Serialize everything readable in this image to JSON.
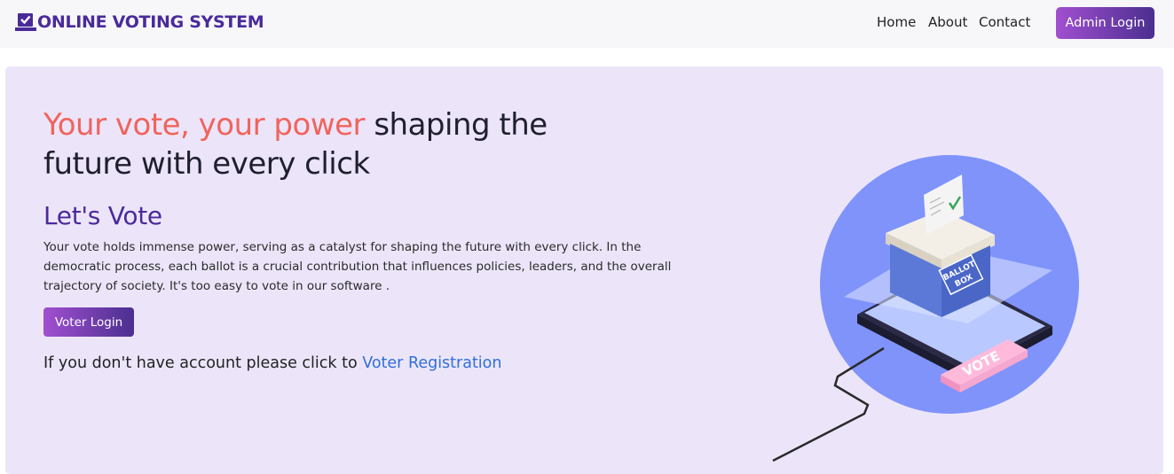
{
  "navbar": {
    "brand_icon": "vote-checkbox-icon",
    "brand_text": "ONLINE VOTING SYSTEM",
    "links": [
      "Home",
      "About",
      "Contact"
    ],
    "admin_login": "Admin Login"
  },
  "hero": {
    "headline_highlight": "Your vote, your power",
    "headline_rest": " shaping the future with every click",
    "subheading": "Let's Vote",
    "description": "Your vote holds immense power, serving as a catalyst for shaping the future with every click. In the democratic process, each ballot is a crucial contribution that influences policies, leaders, and the overall trajectory of society. It's too easy to vote in our software .",
    "voter_login": "Voter Login",
    "registration_prompt": "If you don't have account please click to ",
    "registration_link": "Voter Registration",
    "illustration": {
      "ballot_label_line1": "BALLOT",
      "ballot_label_line2": "BOX",
      "vote_button_text": "VOTE"
    }
  },
  "colors": {
    "brand": "#4a2a9a",
    "highlight": "#f0645d",
    "hero_bg": "#ece5fa",
    "link": "#2f6fd9",
    "button_gradient_start": "#a14fd0",
    "button_gradient_end": "#4b2f8f"
  }
}
